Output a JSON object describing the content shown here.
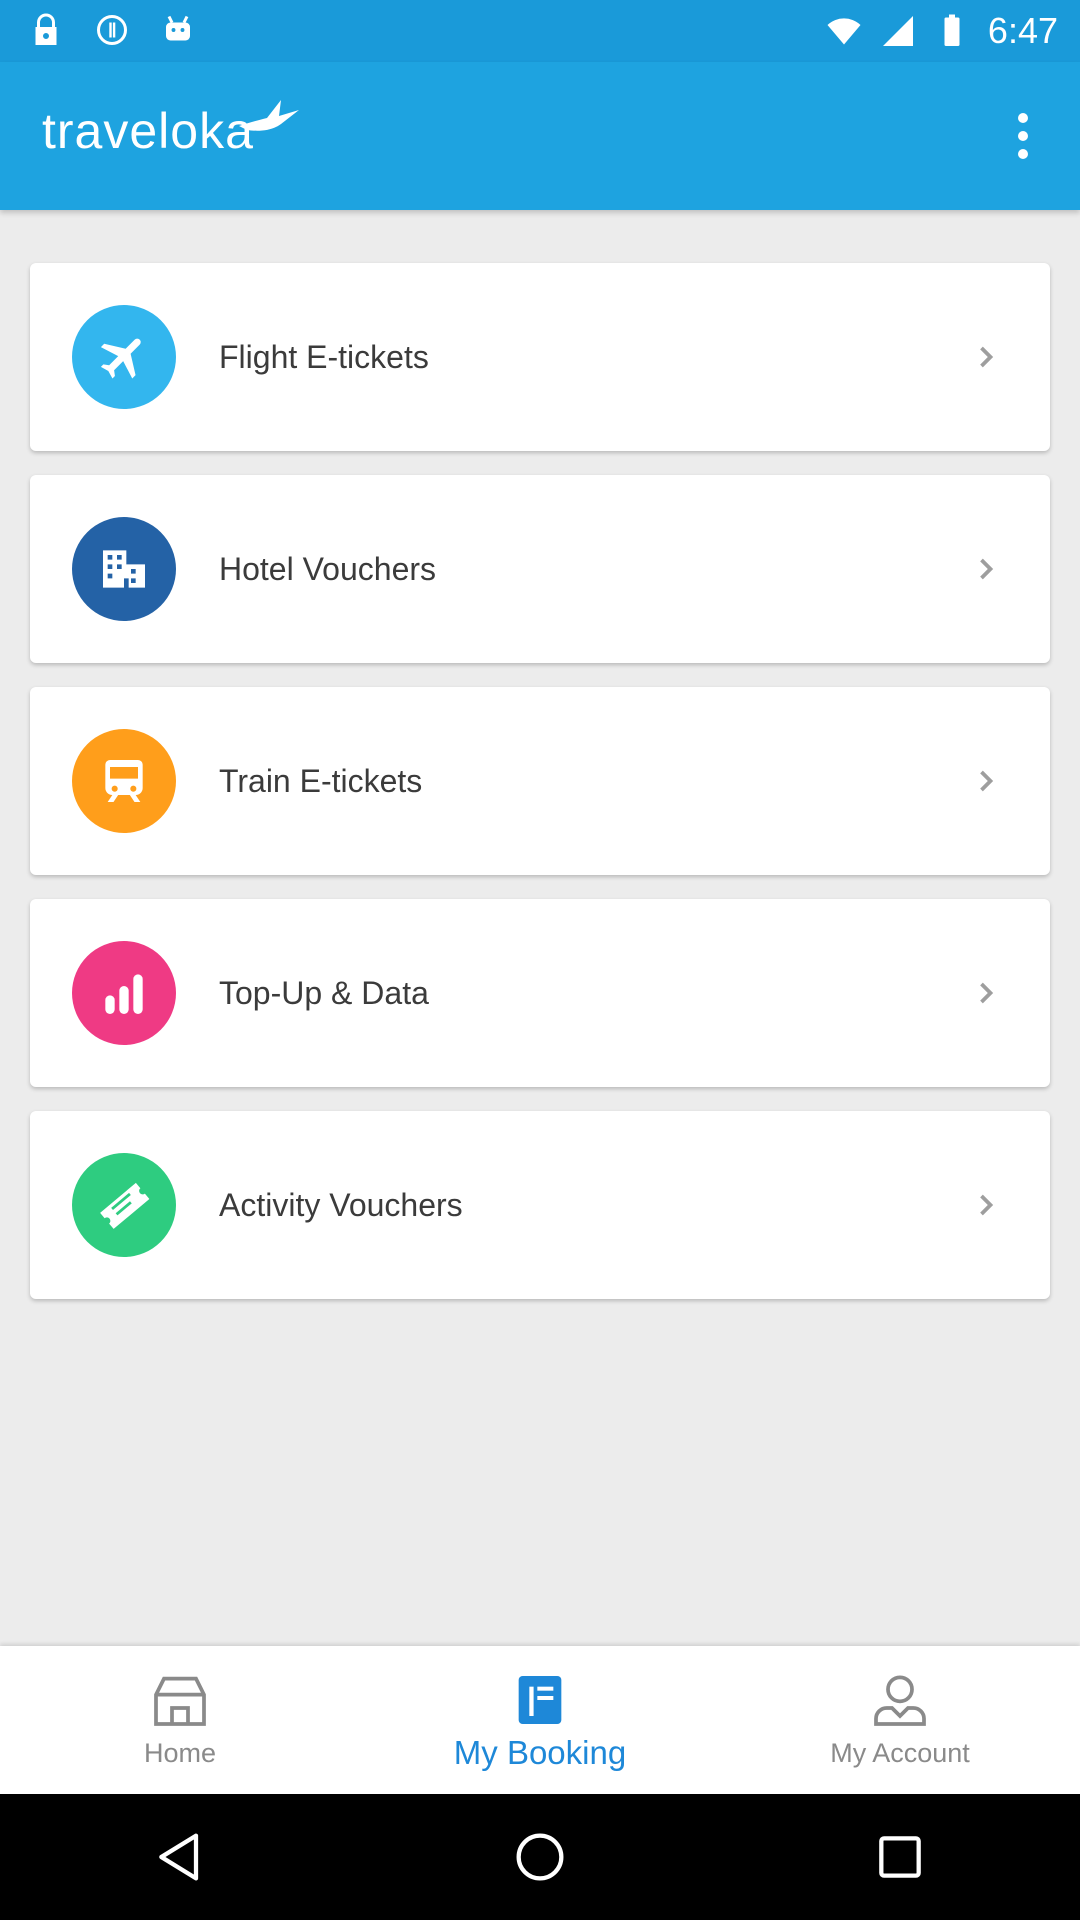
{
  "status_bar": {
    "time": "6:47",
    "icons": [
      "lock-icon",
      "info-icon",
      "android-icon"
    ],
    "right_icons": [
      "wifi-icon",
      "signal-icon",
      "battery-icon"
    ]
  },
  "app_bar": {
    "logo_text": "traveloka",
    "menu_icon": "more-vert-icon"
  },
  "booking_list": [
    {
      "label": "Flight E-tickets",
      "icon": "airplane-icon",
      "color": "#33b6ee"
    },
    {
      "label": "Hotel Vouchers",
      "icon": "hotel-icon",
      "color": "#2462a6"
    },
    {
      "label": "Train E-tickets",
      "icon": "train-icon",
      "color": "#ff9e1b"
    },
    {
      "label": "Top-Up & Data",
      "icon": "signal-bars-icon",
      "color": "#ef3a84"
    },
    {
      "label": "Activity Vouchers",
      "icon": "ticket-icon",
      "color": "#2ecc80"
    }
  ],
  "bottom_nav": {
    "items": [
      {
        "label": "Home",
        "icon": "home-icon",
        "active": false
      },
      {
        "label": "My Booking",
        "icon": "booking-icon",
        "active": true
      },
      {
        "label": "My Account",
        "icon": "account-icon",
        "active": false
      }
    ],
    "active_color": "#1e88d8",
    "inactive_color": "#8a8a8a"
  },
  "system_nav": [
    "back-icon",
    "home-circle-icon",
    "recents-icon"
  ],
  "colors": {
    "status_bar": "#1a9ad9",
    "app_bar": "#1ea3e0",
    "background": "#ececec"
  }
}
